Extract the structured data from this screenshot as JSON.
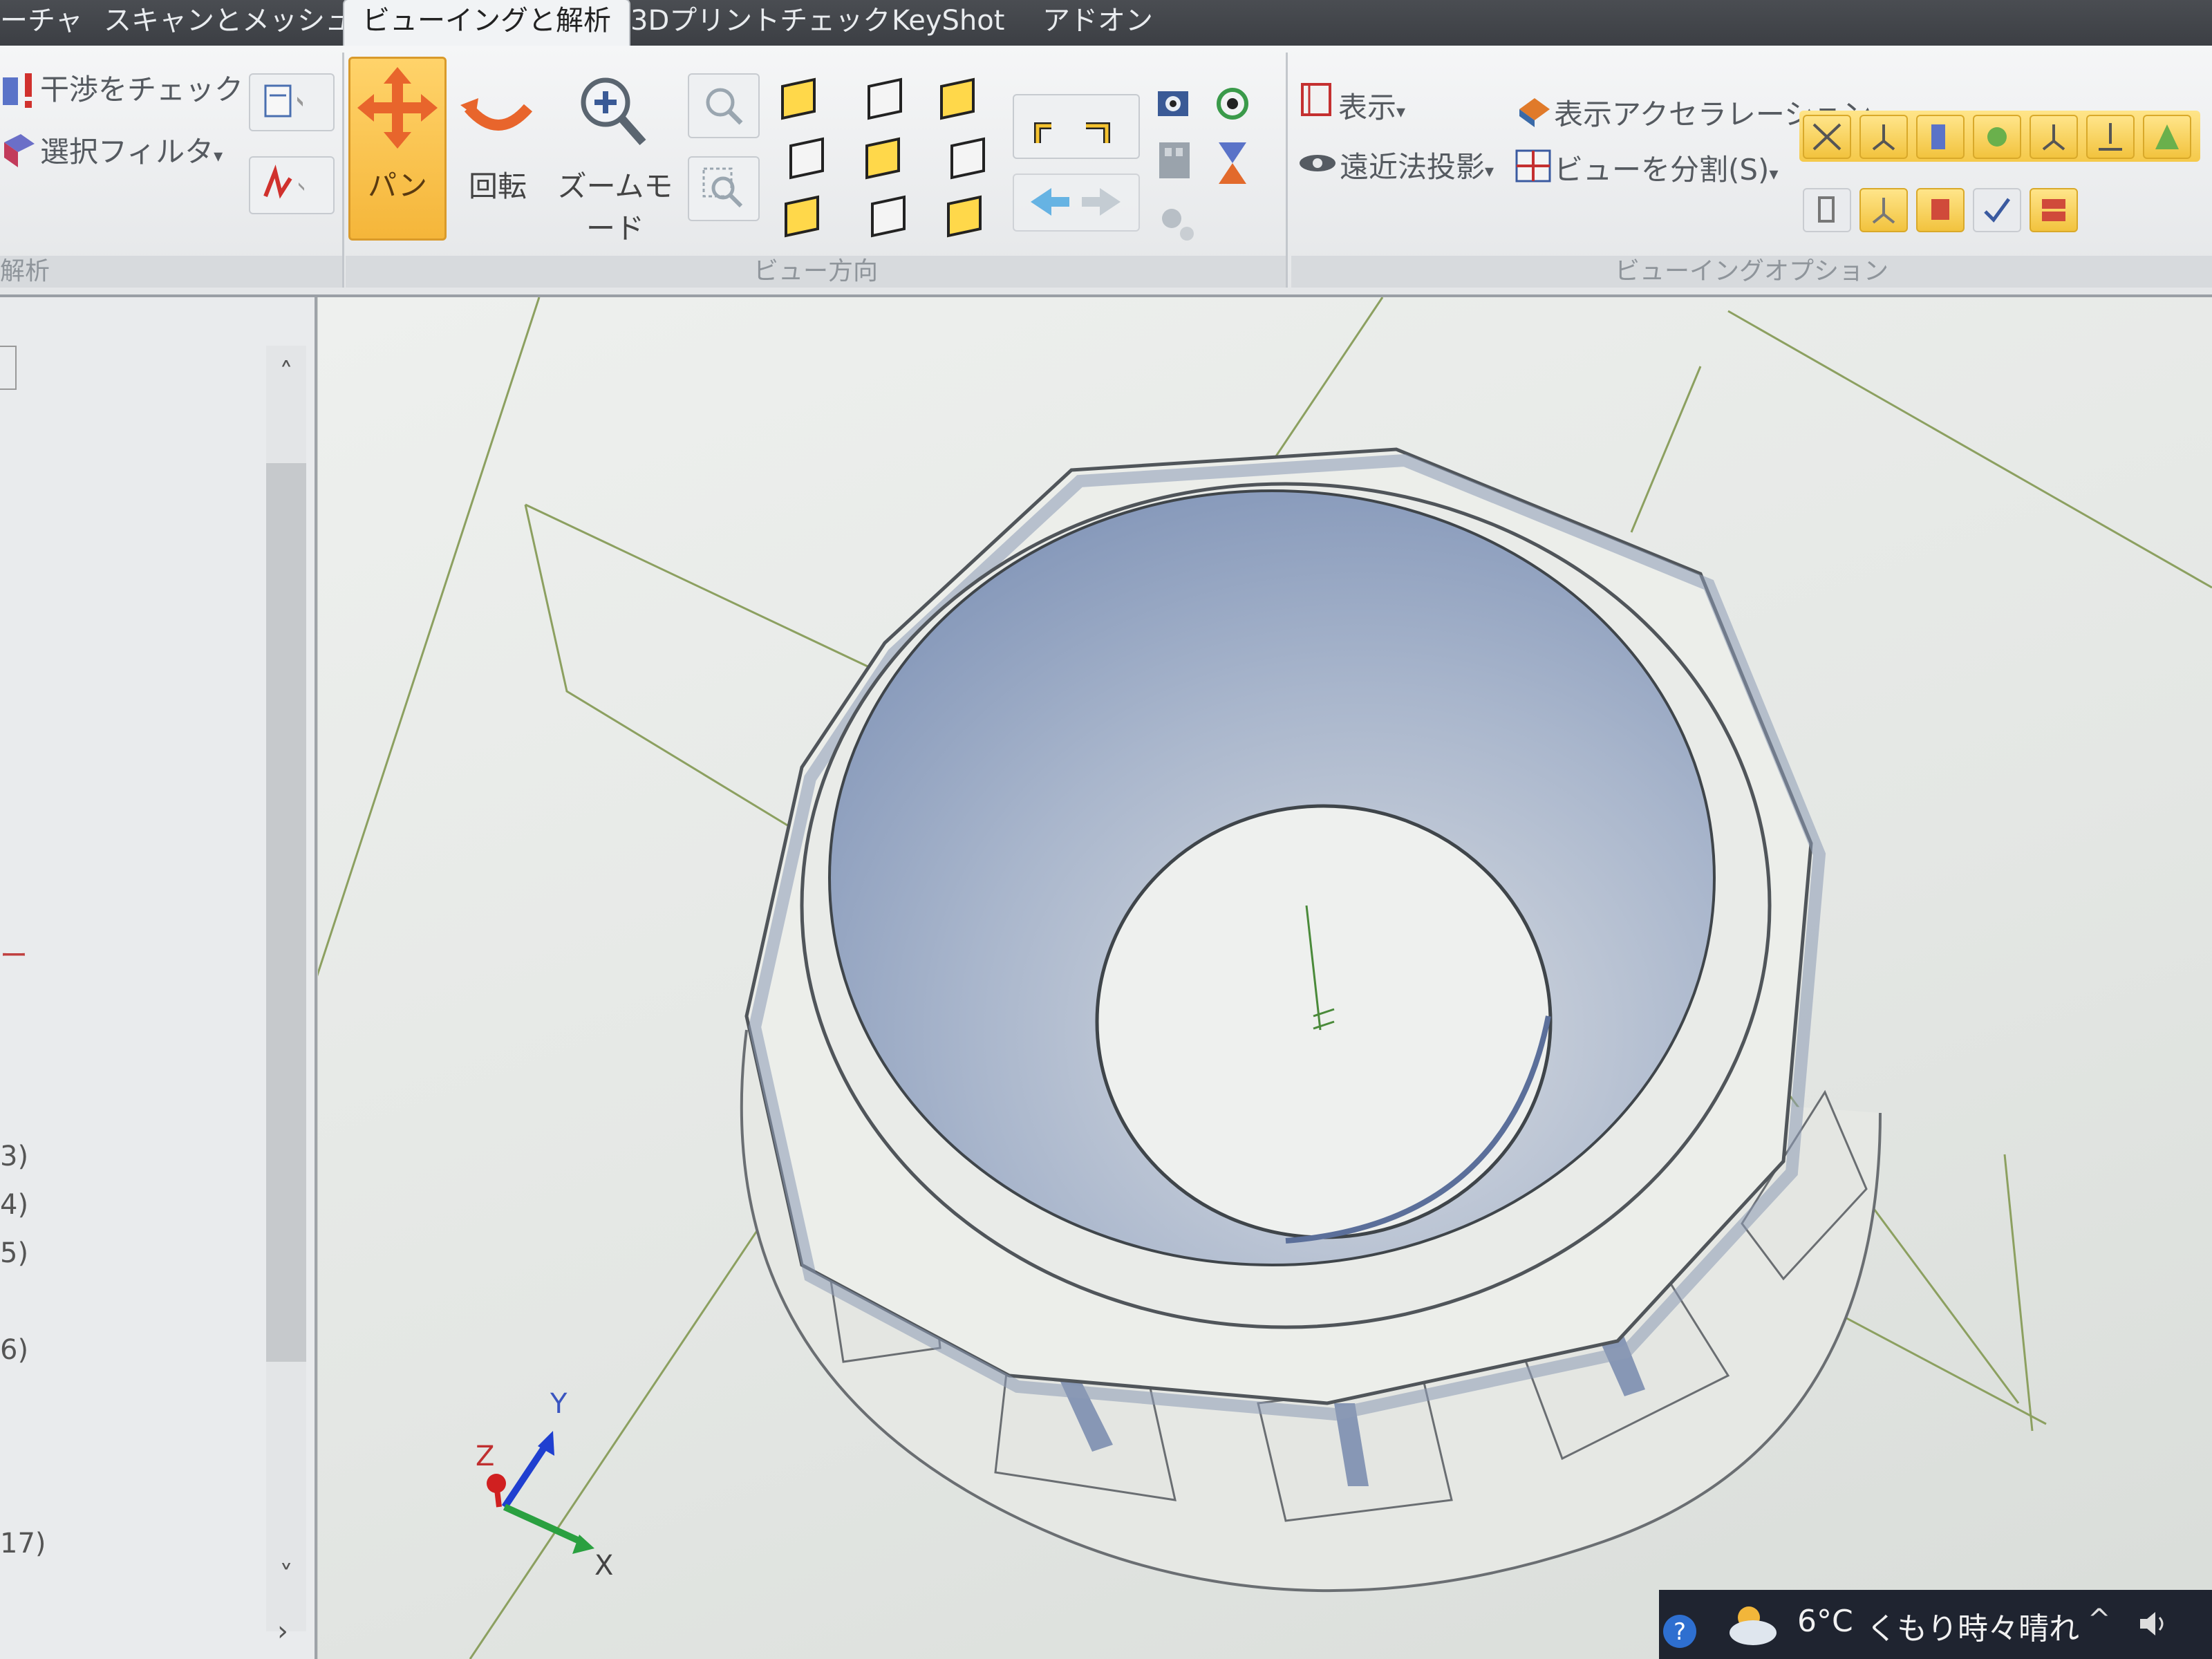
{
  "tabs": [
    {
      "label": "ーチャ",
      "active": false
    },
    {
      "label": "スキャンとメッシュ",
      "active": false
    },
    {
      "label": "ビューイングと解析",
      "active": true
    },
    {
      "label": "3Dプリントチェック",
      "active": false
    },
    {
      "label": "KeyShot",
      "active": false
    },
    {
      "label": "アドオン",
      "active": false
    }
  ],
  "ribbon": {
    "analysis": {
      "interference_label": "干渉をチェック",
      "selection_filter_label": "選択フィルタ",
      "group_label": "解析"
    },
    "view_direction": {
      "pan_label": "パン",
      "rotate_label": "回転",
      "zoom_mode_label": "ズームモード",
      "group_label": "ビュー方向"
    },
    "viewing_options": {
      "display_label": "表示",
      "display_acceleration_label": "表示アクセラレーション",
      "perspective_label": "遠近法投影",
      "split_view_label": "ビューを分割(S)",
      "group_label": "ビューイングオプション"
    }
  },
  "left_panel": {
    "fragments": [
      "ー",
      "3)",
      "4)",
      "5)",
      "6)",
      "17)"
    ]
  },
  "viewport": {
    "axes": {
      "x": "X",
      "y": "Y",
      "z": "Z"
    }
  },
  "taskbar": {
    "temperature": "6°C",
    "weather": "くもり時々晴れ"
  },
  "colors": {
    "pan_button": "#f5b63a",
    "highlight_yellow": "#f2c33e",
    "model_face": "#eceeea",
    "model_inner": "#8da0c0"
  }
}
